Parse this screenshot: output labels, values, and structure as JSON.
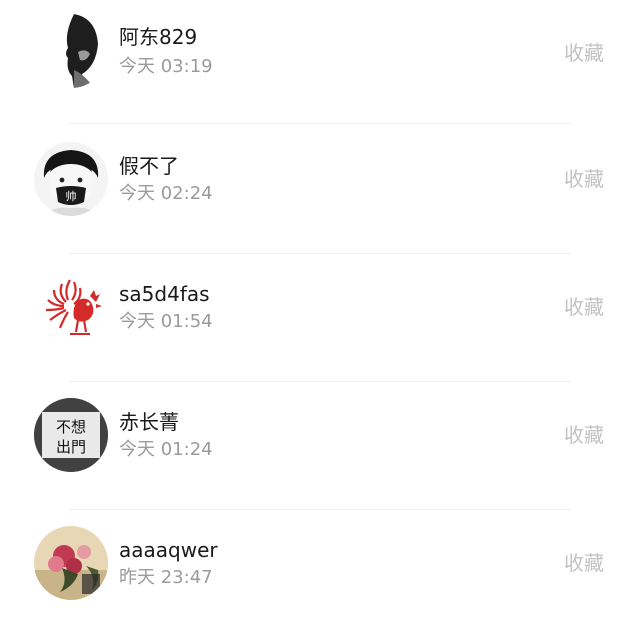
{
  "favorite_label": "收藏",
  "users": [
    {
      "name": "阿东829",
      "time": "今天 03:19",
      "avatar": "bw-silhouette-avatar"
    },
    {
      "name": "假不了",
      "time": "今天 02:24",
      "avatar": "masked-boy-avatar"
    },
    {
      "name": "sa5d4fas",
      "time": "今天 01:54",
      "avatar": "red-rooster-papercut-avatar"
    },
    {
      "name": "赤长菁",
      "time": "今天 01:24",
      "avatar": "text-stamp-avatar",
      "avatar_text": [
        "不想",
        "出門"
      ]
    },
    {
      "name": "aaaaqwer",
      "time": "昨天 23:47",
      "avatar": "floral-avatar"
    }
  ],
  "colors": {
    "name": "#1a1a1a",
    "time": "#9b9b9b",
    "action": "#c2c2c2",
    "divider": "#f0f0f0",
    "rooster_red": "#d42a2a"
  }
}
